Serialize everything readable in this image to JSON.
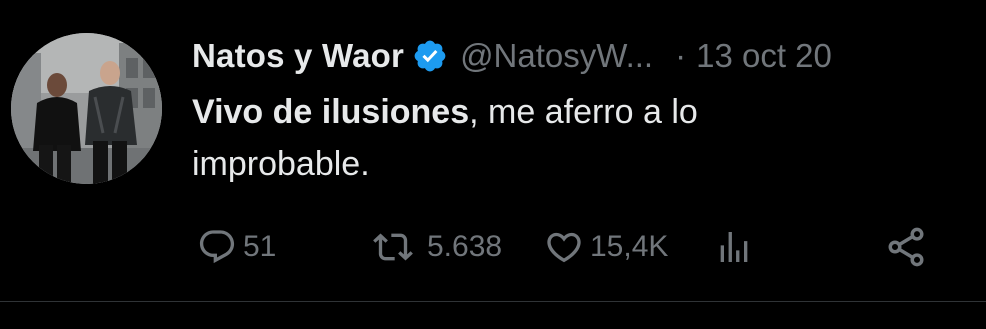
{
  "tweet": {
    "author_name": "Natos y Waor",
    "handle": "@NatosyW...",
    "separator": "·",
    "date": "13 oct 20",
    "text_bold": "Vivo de ilusiones",
    "text_line1_rest": ", me aferro a lo",
    "text_line2": "improbable.",
    "verified": true
  },
  "actions": {
    "replies": "51",
    "retweets": "5.638",
    "likes": "15,4K"
  },
  "colors": {
    "background": "#000000",
    "text": "#e7e9ea",
    "muted": "#71767b",
    "verified_badge": "#1d9bf0",
    "divider": "#2f3336"
  },
  "icons": {
    "reply": "reply-icon",
    "retweet": "retweet-icon",
    "like": "heart-icon",
    "views": "analytics-icon",
    "share": "share-icon",
    "verified": "verified-badge-icon"
  }
}
